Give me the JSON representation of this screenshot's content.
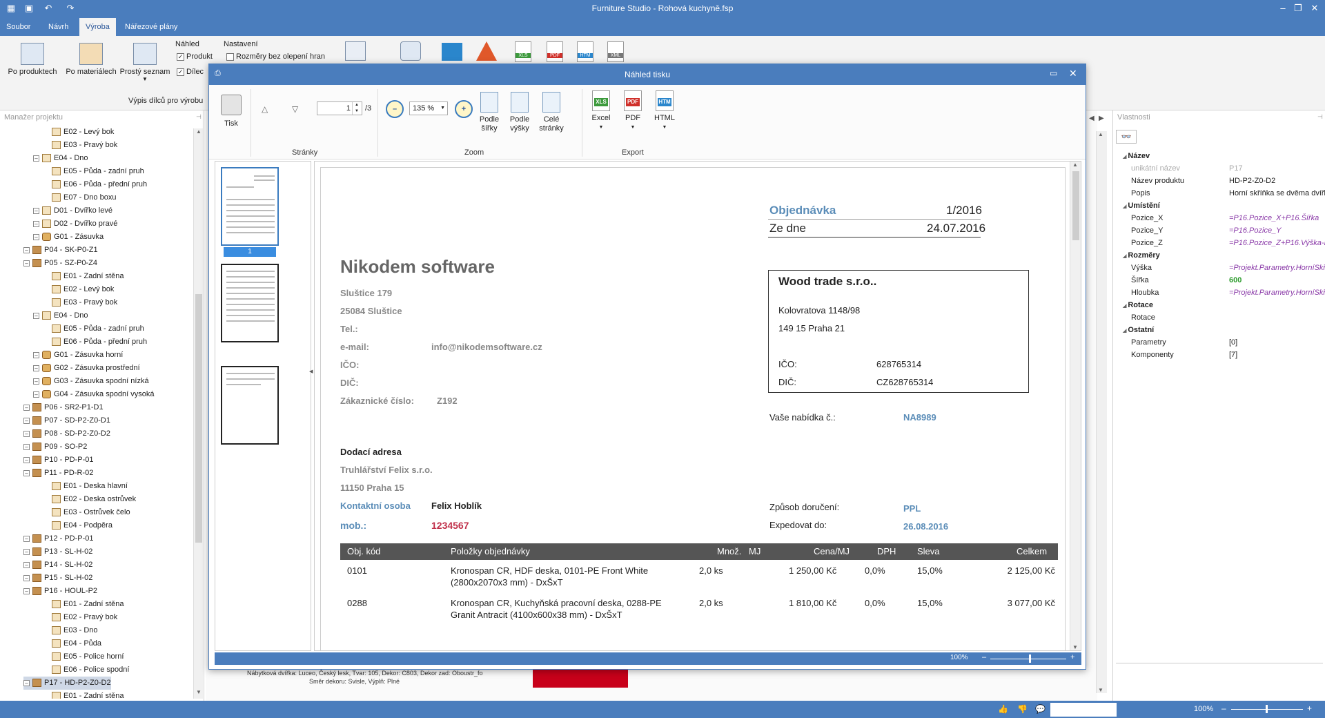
{
  "app": {
    "title": "Furniture Studio - Rohová kuchyně.fsp"
  },
  "menu": {
    "tabs": [
      "Soubor",
      "Návrh",
      "Výroba",
      "Nářezové plány"
    ],
    "active": 2
  },
  "ribbon": {
    "buttons": [
      "Po produktech",
      "Po materiálech",
      "Prostý seznam"
    ],
    "nahled_label": "Náhled",
    "nahled_items": [
      "Produkt",
      "Dílec"
    ],
    "nastaveni_label": "Nastavení",
    "nastaveni_items": [
      "Rozměry bez olepení hran"
    ],
    "group_label": "Výpis dílců pro výrobu"
  },
  "left_pane": {
    "title": "Manažer projektu",
    "tree": [
      {
        "indent": 3,
        "toggle": "",
        "icon": "d",
        "text": "E02 - Levý bok"
      },
      {
        "indent": 3,
        "toggle": "",
        "icon": "d",
        "text": "E03 - Pravý bok"
      },
      {
        "indent": 2,
        "toggle": "–",
        "icon": "d",
        "text": "E04 - Dno"
      },
      {
        "indent": 3,
        "toggle": "",
        "icon": "d",
        "text": "E05 - Půda - zadní pruh"
      },
      {
        "indent": 3,
        "toggle": "",
        "icon": "d",
        "text": "E06 - Půda - přední pruh"
      },
      {
        "indent": 3,
        "toggle": "",
        "icon": "d",
        "text": "E07 - Dno boxu"
      },
      {
        "indent": 2,
        "toggle": "–",
        "icon": "d",
        "text": "D01 - Dvířko levé"
      },
      {
        "indent": 2,
        "toggle": "–",
        "icon": "d",
        "text": "D02 - Dvířko pravé"
      },
      {
        "indent": 2,
        "toggle": "–",
        "icon": "g",
        "text": "G01 - Zásuvka"
      },
      {
        "indent": 1,
        "toggle": "–",
        "icon": "p",
        "text": "P04 - SK-P0-Z1"
      },
      {
        "indent": 1,
        "toggle": "–",
        "icon": "p",
        "text": "P05 - SZ-P0-Z4"
      },
      {
        "indent": 3,
        "toggle": "",
        "icon": "d",
        "text": "E01 - Zadní stěna"
      },
      {
        "indent": 3,
        "toggle": "",
        "icon": "d",
        "text": "E02 - Levý bok"
      },
      {
        "indent": 3,
        "toggle": "",
        "icon": "d",
        "text": "E03 - Pravý bok"
      },
      {
        "indent": 2,
        "toggle": "–",
        "icon": "d",
        "text": "E04 - Dno"
      },
      {
        "indent": 3,
        "toggle": "",
        "icon": "d",
        "text": "E05 - Půda - zadní pruh"
      },
      {
        "indent": 3,
        "toggle": "",
        "icon": "d",
        "text": "E06 - Půda - přední pruh"
      },
      {
        "indent": 2,
        "toggle": "–",
        "icon": "g",
        "text": "G01 - Zásuvka horní"
      },
      {
        "indent": 2,
        "toggle": "–",
        "icon": "g",
        "text": "G02 - Zásuvka prostřední"
      },
      {
        "indent": 2,
        "toggle": "–",
        "icon": "g",
        "text": "G03 - Zásuvka spodní nízká"
      },
      {
        "indent": 2,
        "toggle": "–",
        "icon": "g",
        "text": "G04 - Zásuvka spodní vysoká"
      },
      {
        "indent": 1,
        "toggle": "–",
        "icon": "p",
        "text": "P06 - SR2-P1-D1"
      },
      {
        "indent": 1,
        "toggle": "–",
        "icon": "p",
        "text": "P07 - SD-P2-Z0-D1"
      },
      {
        "indent": 1,
        "toggle": "–",
        "icon": "p",
        "text": "P08 - SD-P2-Z0-D2"
      },
      {
        "indent": 1,
        "toggle": "–",
        "icon": "p",
        "text": "P09 - SO-P2"
      },
      {
        "indent": 1,
        "toggle": "–",
        "icon": "p",
        "text": "P10 - PD-P-01"
      },
      {
        "indent": 1,
        "toggle": "–",
        "icon": "p",
        "text": "P11 - PD-R-02"
      },
      {
        "indent": 3,
        "toggle": "",
        "icon": "d",
        "text": "E01 - Deska hlavní"
      },
      {
        "indent": 3,
        "toggle": "",
        "icon": "d",
        "text": "E02 - Deska ostrůvek"
      },
      {
        "indent": 3,
        "toggle": "",
        "icon": "d",
        "text": "E03 - Ostrůvek čelo"
      },
      {
        "indent": 3,
        "toggle": "",
        "icon": "d",
        "text": "E04 - Podpěra"
      },
      {
        "indent": 1,
        "toggle": "–",
        "icon": "p",
        "text": "P12 - PD-P-01"
      },
      {
        "indent": 1,
        "toggle": "–",
        "icon": "p",
        "text": "P13 - SL-H-02"
      },
      {
        "indent": 1,
        "toggle": "–",
        "icon": "p",
        "text": "P14 - SL-H-02"
      },
      {
        "indent": 1,
        "toggle": "–",
        "icon": "p",
        "text": "P15 - SL-H-02"
      },
      {
        "indent": 1,
        "toggle": "–",
        "icon": "p",
        "text": "P16 - HOUL-P2"
      },
      {
        "indent": 3,
        "toggle": "",
        "icon": "d",
        "text": "E01 - Zadní stěna"
      },
      {
        "indent": 3,
        "toggle": "",
        "icon": "d",
        "text": "E02 - Pravý bok"
      },
      {
        "indent": 3,
        "toggle": "",
        "icon": "d",
        "text": "E03 - Dno"
      },
      {
        "indent": 3,
        "toggle": "",
        "icon": "d",
        "text": "E04 - Půda"
      },
      {
        "indent": 3,
        "toggle": "",
        "icon": "d",
        "text": "E05 - Police horní"
      },
      {
        "indent": 3,
        "toggle": "",
        "icon": "d",
        "text": "E06 - Police spodní"
      },
      {
        "indent": 1,
        "toggle": "–",
        "icon": "p",
        "text": "P17 - HD-P2-Z0-D2",
        "selected": true
      },
      {
        "indent": 3,
        "toggle": "",
        "icon": "d",
        "text": "E01 - Zadní stěna"
      }
    ]
  },
  "right_pane": {
    "title": "Vlastnosti",
    "rows": [
      {
        "type": "cat",
        "text": "Název"
      },
      {
        "type": "row",
        "k": "unikátní název",
        "v": "P17",
        "kgray": true,
        "vgray": true
      },
      {
        "type": "row",
        "k": "Název produktu",
        "v": "HD-P2-Z0-D2"
      },
      {
        "type": "row",
        "k": "Popis",
        "v": "Horní skříňka se dvěma dvířk"
      },
      {
        "type": "cat",
        "text": "Umístění"
      },
      {
        "type": "row",
        "k": "Pozice_X",
        "v": "=P16.Pozice_X+P16.Šířka",
        "vexpr": true
      },
      {
        "type": "row",
        "k": "Pozice_Y",
        "v": "=P16.Pozice_Y",
        "vexpr": true
      },
      {
        "type": "row",
        "k": "Pozice_Z",
        "v": "=P16.Pozice_Z+P16.Výška-P",
        "vexpr": true
      },
      {
        "type": "cat",
        "text": "Rozměry"
      },
      {
        "type": "row",
        "k": "Výška",
        "v": "=Projekt.Parametry.HorníSkří",
        "vexpr": true
      },
      {
        "type": "row",
        "k": "Šířka",
        "v": "600",
        "vgreen": true
      },
      {
        "type": "row",
        "k": "Hloubka",
        "v": "=Projekt.Parametry.HorníSkří",
        "vexpr": true
      },
      {
        "type": "cat",
        "text": "Rotace"
      },
      {
        "type": "row",
        "k": "Rotace",
        "v": ""
      },
      {
        "type": "cat",
        "text": "Ostatní"
      },
      {
        "type": "row",
        "k": "Parametry",
        "v": "[0]"
      },
      {
        "type": "row",
        "k": "Komponenty",
        "v": "[7]"
      }
    ]
  },
  "background_text": {
    "line1": "Nábytková dvířka: Luceo, Český lesk, Tvar: 105, Dekor: C803, Dekor zad: Oboustr_fo",
    "line2": "Směr dekoru: Svisle, Výplň: Plné"
  },
  "dialog": {
    "title": "Náhled tisku",
    "print_label": "Tisk",
    "page_value": "1",
    "page_total": "/3",
    "zoom_value": "135 %",
    "fit_width": [
      "Podle",
      "šířky"
    ],
    "fit_height": [
      "Podle",
      "výšky"
    ],
    "fit_page": [
      "Celé",
      "stránky"
    ],
    "exports": [
      "Excel",
      "PDF",
      "HTML"
    ],
    "groups": [
      "Stránky",
      "Zoom",
      "Export"
    ],
    "thumb_selected": "1",
    "status_zoom": "100%"
  },
  "document": {
    "order_label": "Objednávka",
    "order_no": "1/2016",
    "date_label": "Ze dne",
    "date": "24.07.2016",
    "company": "Nikodem software",
    "addr1": "Sluštice 179",
    "addr2": "25084 Sluštice",
    "tel_label": "Tel.:",
    "email_label": "e-mail:",
    "email": "info@nikodemsoftware.cz",
    "ico_label": "IČO:",
    "dic_label": "DIČ:",
    "cust_label": "Zákaznické číslo:",
    "cust_no": "Z192",
    "supplier": "Wood trade  s.r.o..",
    "sup_addr1": "Kolovratova 1148/98",
    "sup_addr2": "149 15 Praha 21",
    "sup_ico_label": "IČO:",
    "sup_ico": "628765314",
    "sup_dic_label": "DIČ:",
    "sup_dic": "CZ628765314",
    "offer_label": "Vaše nabídka č.:",
    "offer": "NA8989",
    "delivery_heading": "Dodací adresa",
    "del1": "Truhlářství Felix s.r.o.",
    "del2": "11150 Praha 15",
    "contact_label": "Kontaktní osoba",
    "contact": "Felix Hoblík",
    "mob_label": "mob.:",
    "mob": "1234567",
    "ship_label": "Způsob doručení:",
    "ship": "PPL",
    "expedite_label": "Expedovat do:",
    "expedite": "26.08.2016",
    "columns": [
      "Obj. kód",
      "Položky objednávky",
      "Množ.",
      "MJ",
      "Cena/MJ",
      "DPH",
      "Sleva",
      "Celkem"
    ],
    "rows": [
      {
        "code": "0101",
        "item1": "Kronospan CR, HDF deska, 0101-PE Front White",
        "item2": "(2800x2070x3 mm) - DxŠxT",
        "qty": "2,0 ks",
        "price": "1 250,00 Kč",
        "vat": "0,0%",
        "disc": "15,0%",
        "total": "2 125,00 Kč"
      },
      {
        "code": "0288",
        "item1": "Kronospan CR, Kuchyňská pracovní deska, 0288-PE",
        "item2": "Granit Antracit (4100x600x38 mm) - DxŠxT",
        "qty": "2,0 ks",
        "price": "1 810,00 Kč",
        "vat": "0,0%",
        "disc": "15,0%",
        "total": "3 077,00 Kč"
      }
    ]
  },
  "statusbar": {
    "zoom": "100%"
  }
}
